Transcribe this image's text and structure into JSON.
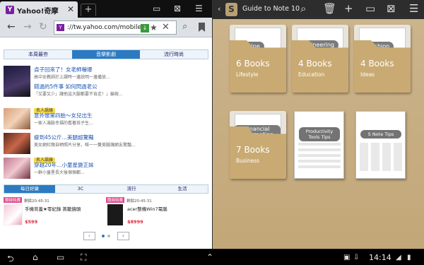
{
  "browser": {
    "tab": {
      "title": "Yahoo!奇摩",
      "logo_letter": "Y"
    },
    "new_tab_label": "+",
    "url": "://tw.yahoo.com/mobile/",
    "category_tabs": [
      "本周最夯",
      "音樂影劇",
      "流行時尚"
    ],
    "active_category": 1,
    "news": [
      {
        "headline": "貞子回來了！女老師嚇爆",
        "sub": "高中女教師於上課時一邊說明一邊播放...",
        "badge": ""
      },
      {
        "headline": "錯過的5件事 如何閃過老公",
        "sub": "「又要又少」讓他這大腿都要不肯走！」編按...",
        "badge": ""
      },
      {
        "headline": "意外懷第四胎～女兒出生",
        "sub": "一家人滿臉幸福的看著孩子生...",
        "badge": "名人語錄"
      },
      {
        "headline": "瘦到45公斤…美腿超驚豔",
        "sub": "美女網紅親自晒照片分享，唯一一雙美腿讓網友驚豔...",
        "badge": ""
      },
      {
        "headline": "穿越20年…小童星變正妹",
        "sub": "一群小童星長大後個個都...",
        "badge": "名人語錄"
      }
    ],
    "daily_tabs": [
      "每日好康",
      "3C",
      "流行",
      "生活"
    ],
    "active_daily": 0,
    "products": [
      {
        "tag": "限時特賣",
        "time": "剩餘20:45:31",
        "name": "手機背蓋★零紀錄 蒸籠鏡頭",
        "price": "$599"
      },
      {
        "tag": "限時特賣",
        "time": "剩餘20:45:31",
        "name": "acer整機Win7電腦",
        "price": "$8999"
      }
    ],
    "pager": {
      "prev": "‹",
      "next": "›"
    }
  },
  "snote": {
    "title": "Guide to Note 10",
    "app_letter": "S",
    "folders": [
      {
        "pill": "Recipe",
        "count": "6 Books",
        "category": "Lifestyle"
      },
      {
        "pill": "Engineering",
        "count": "4 Books",
        "category": "Education"
      },
      {
        "pill": "Fashion",
        "count": "4 Books",
        "category": "Ideas"
      },
      {
        "pill": "Financial Information",
        "count": "7 Books",
        "category": "Business"
      }
    ],
    "notes": [
      {
        "pill": "Productivity Tools Tips"
      },
      {
        "pill": "S Note Tips"
      }
    ]
  },
  "system": {
    "clock": "14:14"
  },
  "colors": {
    "snote_bg": "#c7ad82",
    "folder_front": "#c9aa72",
    "browser_tab_active": "#2c7bc2",
    "price_red": "#e0283c"
  }
}
